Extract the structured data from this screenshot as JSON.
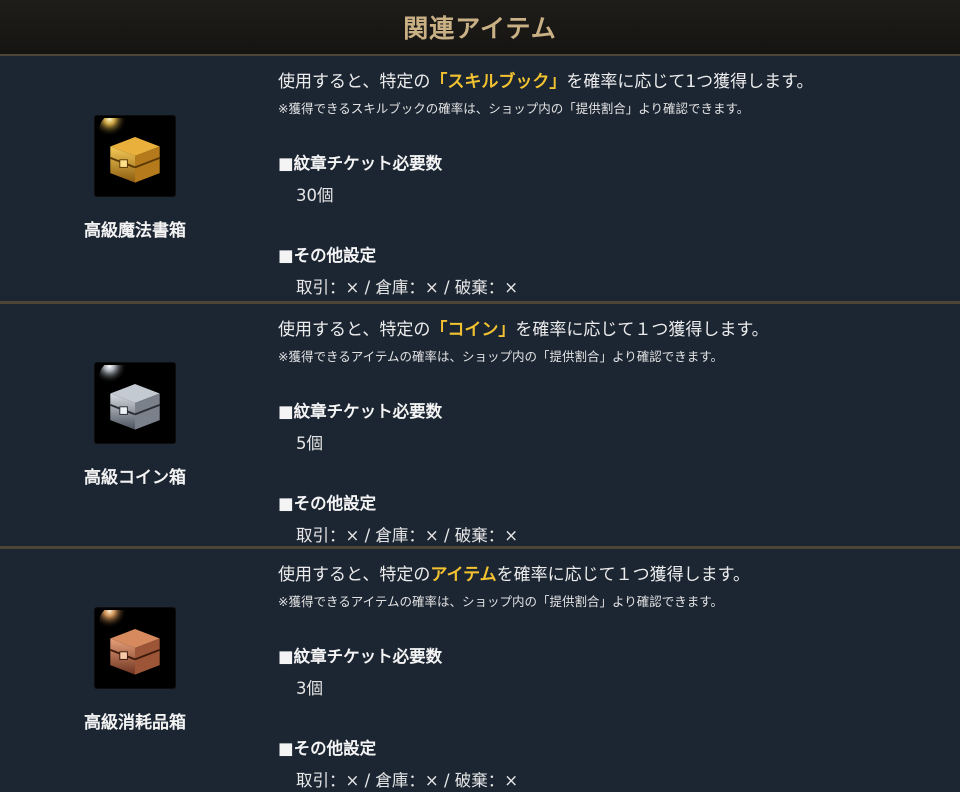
{
  "header": {
    "title": "関連アイテム"
  },
  "items": [
    {
      "name": "高級魔法書箱",
      "icon": "gold-treasure-chest-icon",
      "desc_pre": "使用すると、特定の",
      "desc_hl": "「スキルブック」",
      "desc_post": "を確率に応じて1つ獲得します。",
      "note": "※獲得できるスキルブックの確率は、ショップ内の「提供割合」より確認できます。",
      "req_label": "■紋章チケット必要数",
      "req_value": "30個",
      "other_label": "■その他設定",
      "other_value": "取引：× / 倉庫：× / 破棄：×"
    },
    {
      "name": "高級コイン箱",
      "icon": "silver-treasure-chest-icon",
      "desc_pre": "使用すると、特定の",
      "desc_hl": "「コイン」",
      "desc_post": "を確率に応じて１つ獲得します。",
      "note": "※獲得できるアイテムの確率は、ショップ内の「提供割合」より確認できます。",
      "req_label": "■紋章チケット必要数",
      "req_value": "5個",
      "other_label": "■その他設定",
      "other_value": "取引：× / 倉庫：× / 破棄：×"
    },
    {
      "name": "高級消耗品箱",
      "icon": "copper-treasure-chest-icon",
      "desc_pre": "使用すると、特定の",
      "desc_hl": "アイテム",
      "desc_post": "を確率に応じて１つ獲得します。",
      "note": "※獲得できるアイテムの確率は、ショップ内の「提供割合」より確認できます。",
      "req_label": "■紋章チケット必要数",
      "req_value": "3個",
      "other_label": "■その他設定",
      "other_value": "取引：× / 倉庫：× / 破棄：×"
    }
  ],
  "colors": {
    "background": "#1c2633",
    "header_title": "#c9b185",
    "highlight": "#f2c230",
    "divider": "#4d4536"
  }
}
